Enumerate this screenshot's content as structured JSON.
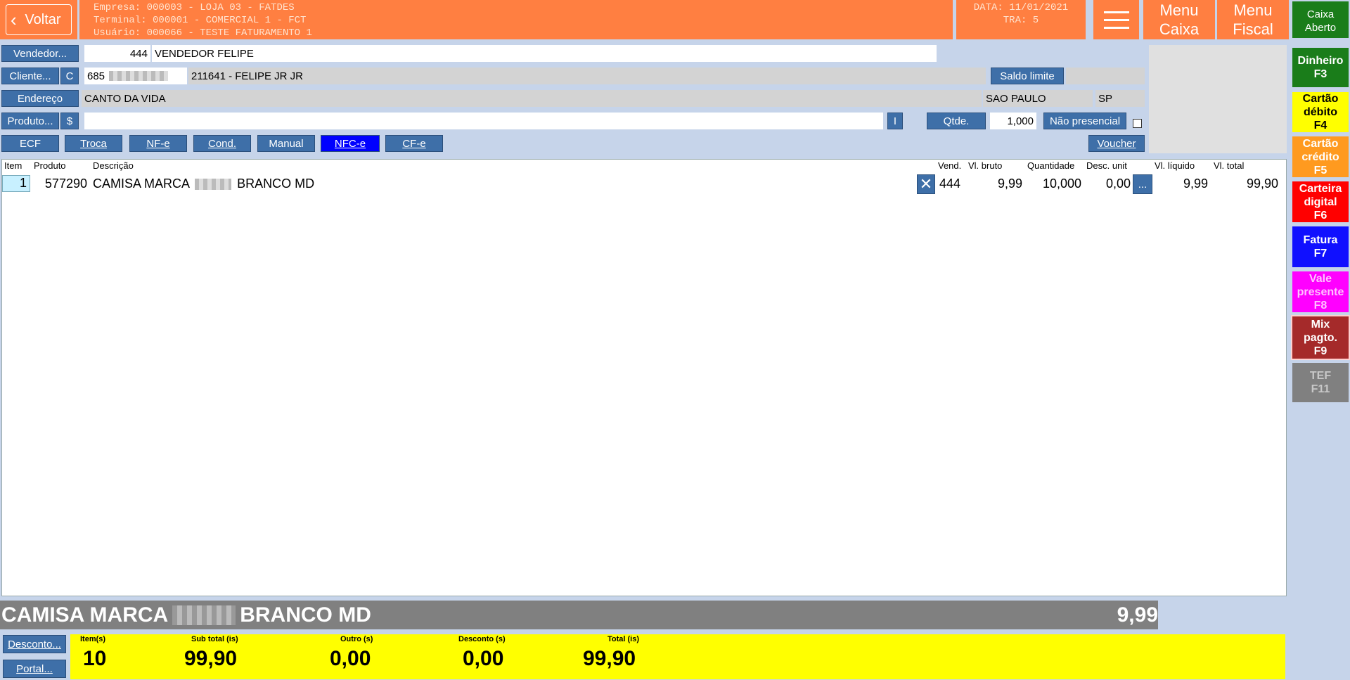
{
  "header": {
    "back_label": "Voltar",
    "empresa": "Empresa: 000003 - LOJA 03 - FATDES",
    "terminal": "Terminal: 000001 - COMERCIAL 1 - FCT",
    "usuario": "Usuário: 000066 - TESTE FATURAMENTO 1",
    "data": "DATA: 11/01/2021",
    "tra": "TRA: 5",
    "menu_caixa_1": "Menu",
    "menu_caixa_2": "Caixa",
    "menu_fiscal_1": "Menu",
    "menu_fiscal_2": "Fiscal",
    "caixa_status_1": "Caixa",
    "caixa_status_2": "Aberto"
  },
  "form": {
    "vendedor_btn": "Vendedor...",
    "vendedor_code": "444",
    "vendedor_name": "VENDEDOR FELIPE",
    "cliente_btn": "Cliente...",
    "cliente_c_btn": "C",
    "cliente_doc_prefix": "685",
    "cliente_name": "211641 - FELIPE JR JR",
    "saldo_btn": "Saldo limite",
    "endereco_btn": "Endereço",
    "endereco": "CANTO DA VIDA",
    "cidade": "SAO PAULO",
    "uf": "SP",
    "produto_btn": "Produto...",
    "produto_dollar_btn": "$",
    "produto_value": "",
    "produto_i_btn": "I",
    "qtde_btn": "Qtde.",
    "qtde_value": "1,000",
    "nao_presencial_btn": "Não presencial"
  },
  "modes": [
    "ECF",
    "Troca",
    "NF-e",
    "Cond.",
    "Manual",
    "NFC-e",
    "CF-e"
  ],
  "voucher_btn": "Voucher",
  "grid": {
    "headers": {
      "item": "Item",
      "produto": "Produto",
      "descricao": "Descrição",
      "vend": "Vend.",
      "vl_bruto": "Vl. bruto",
      "quantidade": "Quantidade",
      "desc_unit": "Desc. unit",
      "vl_liquido": "Vl. líquido",
      "vl_total": "Vl. total"
    },
    "rows": [
      {
        "item": "1",
        "produto": "577290",
        "descricao_a": "CAMISA MARCA",
        "descricao_b": "BRANCO MD",
        "vend": "444",
        "vl_bruto": "9,99",
        "quantidade": "10,000",
        "desc_unit": "0,00",
        "more_btn": "...",
        "vl_liquido": "9,99",
        "vl_total": "99,90"
      }
    ]
  },
  "payments": [
    {
      "label_1": "Dinheiro",
      "label_2": "F3",
      "color": "#1a7d1a",
      "text": "#ffffff"
    },
    {
      "label_1": "Cartão",
      "label_2": "débito",
      "label_3": "F4",
      "color": "#ffff00",
      "text": "#000000"
    },
    {
      "label_1": "Cartão",
      "label_2": "crédito",
      "label_3": "F5",
      "color": "#ff9a1f",
      "text": "#ffffff"
    },
    {
      "label_1": "Carteira",
      "label_2": "digital",
      "label_3": "F6",
      "color": "#ff0000",
      "text": "#ffffff"
    },
    {
      "label_1": "Fatura",
      "label_2": "F7",
      "color": "#1010ff",
      "text": "#ffffff"
    },
    {
      "label_1": "Vale",
      "label_2": "presente",
      "label_3": "F8",
      "color": "#ff00ff",
      "text": "#ffc0ff"
    },
    {
      "label_1": "Mix",
      "label_2": "pagto.",
      "label_3": "F9",
      "color": "#a52a2a",
      "text": "#ffffff"
    },
    {
      "label_1": "TEF",
      "label_2": "F11",
      "color": "#808080",
      "text": "#c8c8c8"
    }
  ],
  "summary": {
    "desc_a": "CAMISA MARCA",
    "desc_b": "BRANCO MD",
    "price": "9,99"
  },
  "bottom_buttons": {
    "desconto": "Desconto...",
    "portal": "Portal..."
  },
  "totals": {
    "itens_label": "Item(s)",
    "itens": "10",
    "subtotal_label": "Sub total (is)",
    "subtotal": "99,90",
    "outro_label": "Outro (s)",
    "outro": "0,00",
    "desconto_label": "Desconto (s)",
    "desconto": "0,00",
    "total_label": "Total (is)",
    "total": "99,90"
  }
}
